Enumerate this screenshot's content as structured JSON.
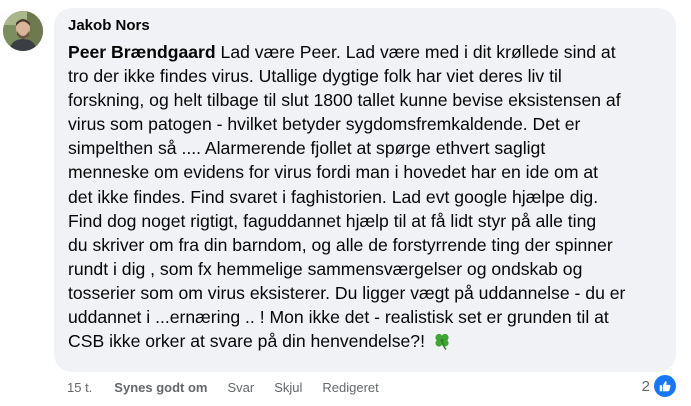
{
  "comment": {
    "author": "Jakob Nors",
    "mention": "Peer Brændgaard",
    "text_lines": [
      " Lad være Peer. Lad være med i dit krøllede sind at",
      "tro der ikke findes virus. Utallige dygtige folk har viet deres liv til",
      "forskning, og helt tilbage til slut 1800 tallet kunne bevise eksistensen af",
      "virus som patogen - hvilket betyder sygdomsfremkaldende. Det er",
      "simpelthen så .... Alarmerende fjollet at spørge ethvert sagligt",
      "menneske om evidens for virus fordi man i hovedet har en ide om at",
      "det ikke findes. Find svaret i faghistorien. Lad evt google hjælpe dig.",
      "Find dog noget rigtigt, faguddannet hjælp til at få lidt styr på alle ting",
      "du skriver om fra din barndom, og alle de forstyrrende ting der spinner",
      "rundt i dig , som fx hemmelige sammensværgelser og ondskab og",
      "tosserier som om virus eksisterer. Du ligger vægt på uddannelse - du er",
      "uddannet i ...ernæring .. ! Mon ikke det - realistisk set er grunden til at",
      "CSB ikke orker at svare på din henvendelse?! "
    ],
    "emoji": "four-leaf-clover-icon"
  },
  "actions": {
    "time": "15 t.",
    "like": "Synes godt om",
    "reply": "Svar",
    "hide": "Skjul",
    "edited": "Redigeret"
  },
  "reactions": {
    "count": "2",
    "type": "like-icon",
    "color": "#1877f2"
  },
  "colors": {
    "bubble": "#f0f2f5",
    "text": "#050505",
    "meta": "#65676b",
    "clover": "#3fa535"
  }
}
